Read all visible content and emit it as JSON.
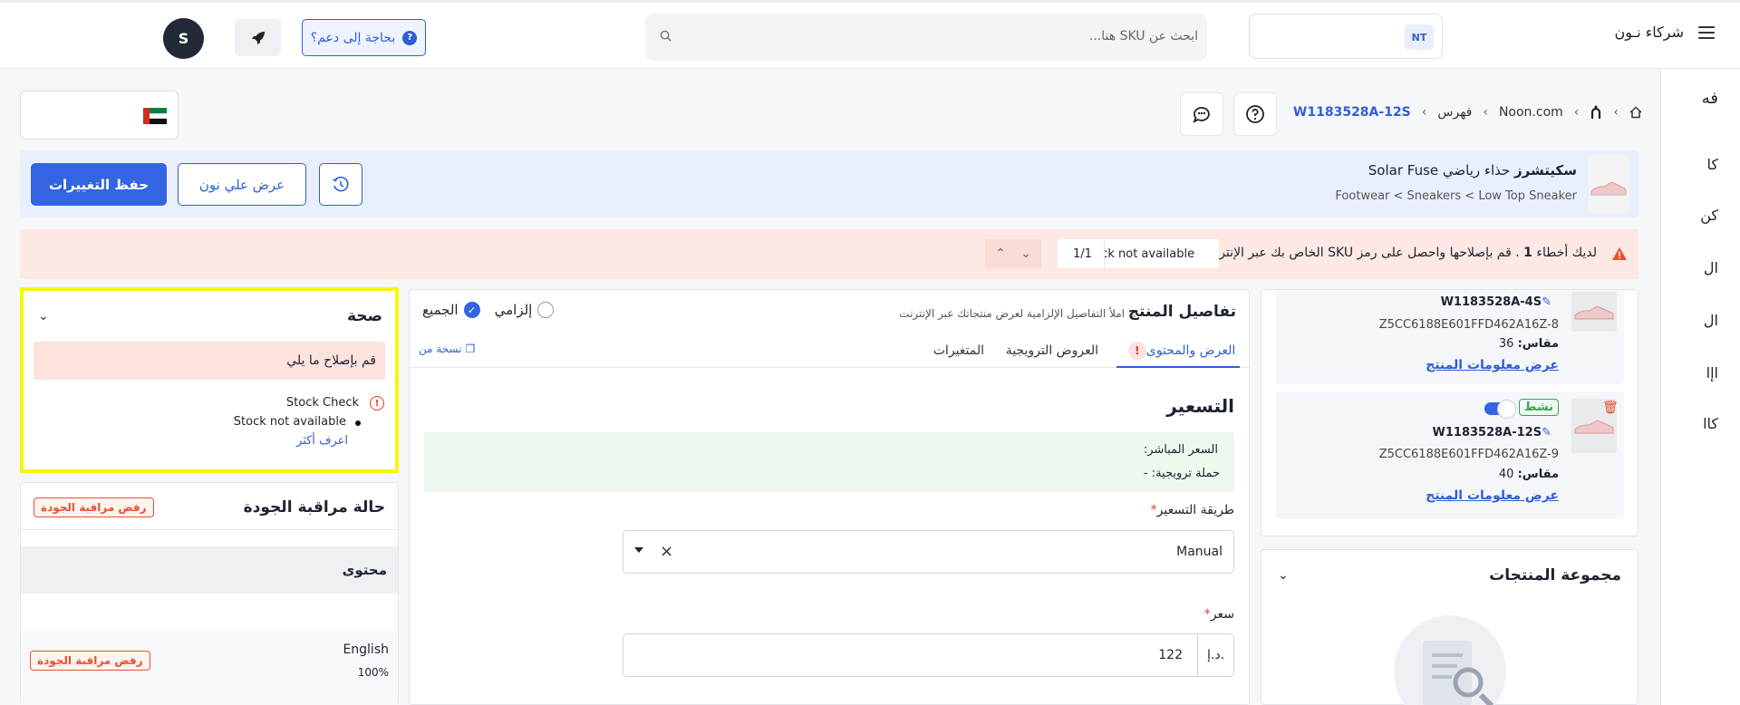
{
  "topbar": {
    "brand": "شركاء نـون",
    "partner_badge": "NT",
    "search_placeholder": "ابحث عن SKU هنا...",
    "support_label": "بحاجة إلى دعم؟",
    "avatar_initial": "S"
  },
  "sidebar": {
    "items": [
      "فه",
      "كا",
      "كن",
      "ال",
      "ال",
      "اإا",
      "كاا"
    ]
  },
  "breadcrumb": {
    "items": [
      "Noon.com",
      "فهرس",
      "W1183528A-12S"
    ]
  },
  "product": {
    "brand": "سكيتشرز",
    "title": "حذاء رياضي Solar Fuse",
    "path": "Footwear < Sneakers < Low Top Sneaker",
    "save_label": "حفظ التغييرات",
    "view_label": "عرض علي نون"
  },
  "error_bar": {
    "text_before": "لديك أخطاء ",
    "count": "1",
    "text_after": " . قم بإصلاحها واحصل على رمز SKU الخاص بك عبر الإنترنت",
    "tag": "Stock not available",
    "pager": "1/1"
  },
  "health": {
    "title": "صحة",
    "fix_label": "قم بإصلاح ما يلي",
    "check_name": "Stock Check",
    "issue": "Stock not available",
    "learn_more": "اعرف أكثر"
  },
  "qc": {
    "title": "حالة مراقبة الجودة",
    "reject_label": "رفض مراقبة الجودة",
    "content_label": "محتوى",
    "language": "English",
    "percent": "100%",
    "lang_reject_label": "رفض مراقبة الجودة"
  },
  "details": {
    "title": "تفاصيل المنتج",
    "subtitle": "املأ التفاصيل الإلزامية لعرض منتجاتك عبر الإنترنت",
    "radio_mandatory": "إلزامي",
    "radio_all": "الجميع",
    "tabs": [
      "العرض والمحتوى",
      "العروض الترويجية",
      "المتغيرات"
    ],
    "copy_from": "نسخة من",
    "pricing_title": "التسعير",
    "live_price": "السعر المباشر:",
    "promo": "حملة ترويجية: -",
    "pricing_method_label": "طريقة التسعير",
    "pricing_method_value": "Manual",
    "price_label": "سعر",
    "currency": "د.إ.",
    "price_value": "122"
  },
  "variants": [
    {
      "sku": "W1183528A-4S",
      "code": "Z5CC6188E601FFD462A16Z-8",
      "size_label": "مقاس:",
      "size": "36",
      "link": "عرض معلومات المنتج"
    },
    {
      "sku": "W1183528A-12S",
      "code": "Z5CC6188E601FFD462A16Z-9",
      "size_label": "مقاس:",
      "size": "40",
      "link": "عرض معلومات المنتج",
      "status": "نشط"
    }
  ],
  "group": {
    "title": "مجموعة المنتجات"
  }
}
